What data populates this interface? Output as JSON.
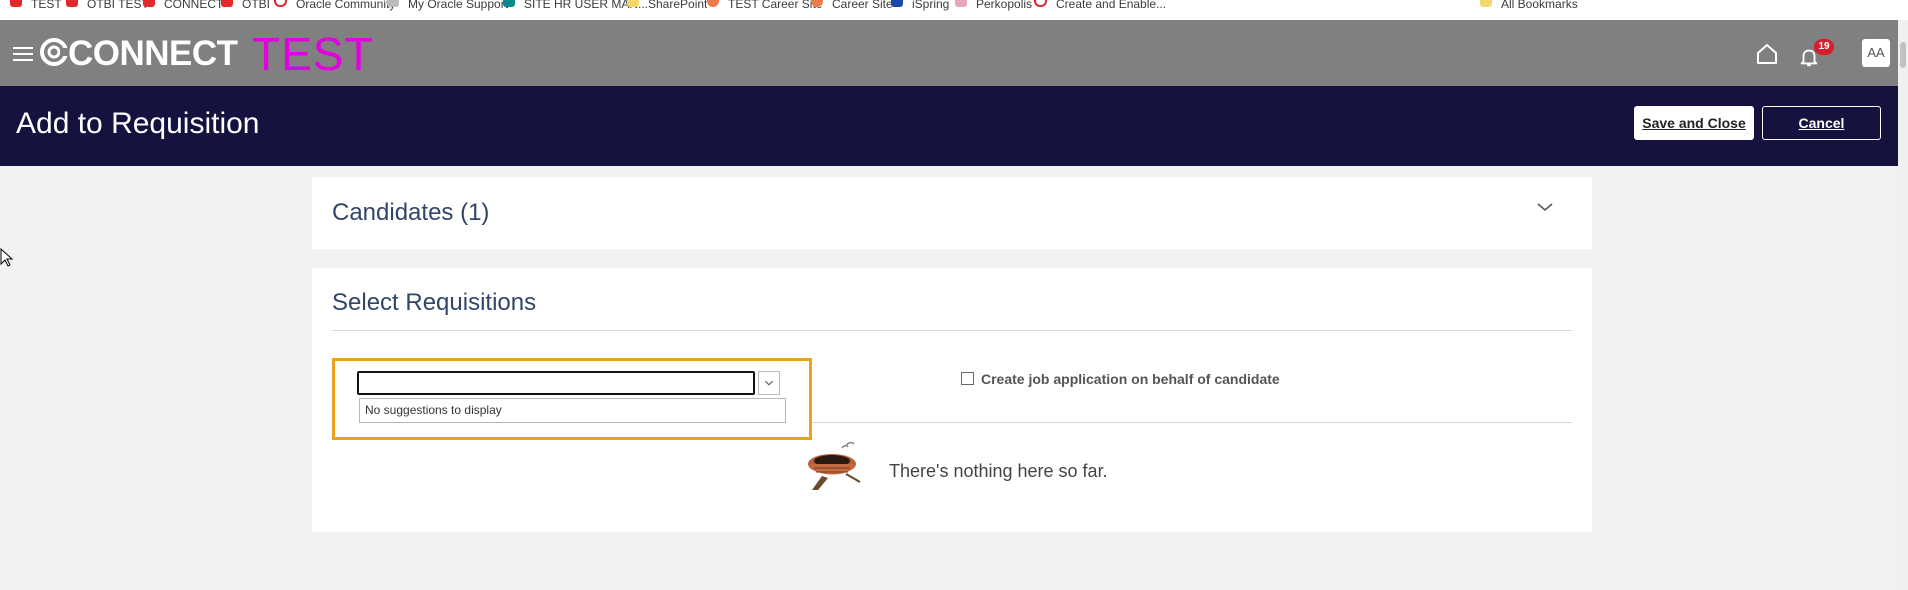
{
  "bookmarks": {
    "items": [
      {
        "label": "TEST"
      },
      {
        "label": "OTBI TEST"
      },
      {
        "label": "CONNECT"
      },
      {
        "label": "OTBI"
      },
      {
        "label": "Oracle Community"
      },
      {
        "label": "My Oracle Support"
      },
      {
        "label": "SITE HR USER MAN..."
      },
      {
        "label": "SharePoint"
      },
      {
        "label": "TEST Career Site"
      },
      {
        "label": "Career Site"
      },
      {
        "label": "iSpring"
      },
      {
        "label": "Perkopolis"
      },
      {
        "label": "Create and Enable..."
      }
    ],
    "all_bookmarks": "All Bookmarks"
  },
  "header": {
    "brand": "CONNECT",
    "environment": "TEST",
    "notification_count": "19",
    "avatar_initials": "AA"
  },
  "page": {
    "title": "Add to Requisition",
    "save_label": "Save and Close",
    "cancel_label": "Cancel"
  },
  "candidates": {
    "title": "Candidates (1)"
  },
  "requisitions": {
    "title": "Select Requisitions",
    "search_value": "",
    "suggestions_empty": "No suggestions to display",
    "checkbox_label": "Create job application on behalf of candidate",
    "checkbox_checked": false,
    "empty_message": "There's nothing here so far."
  },
  "colors": {
    "app_bar": "#808080",
    "page_header": "#15123f",
    "environment_label": "#e000e0",
    "focus_outline": "#e9a31a",
    "badge": "#d61f2c"
  }
}
